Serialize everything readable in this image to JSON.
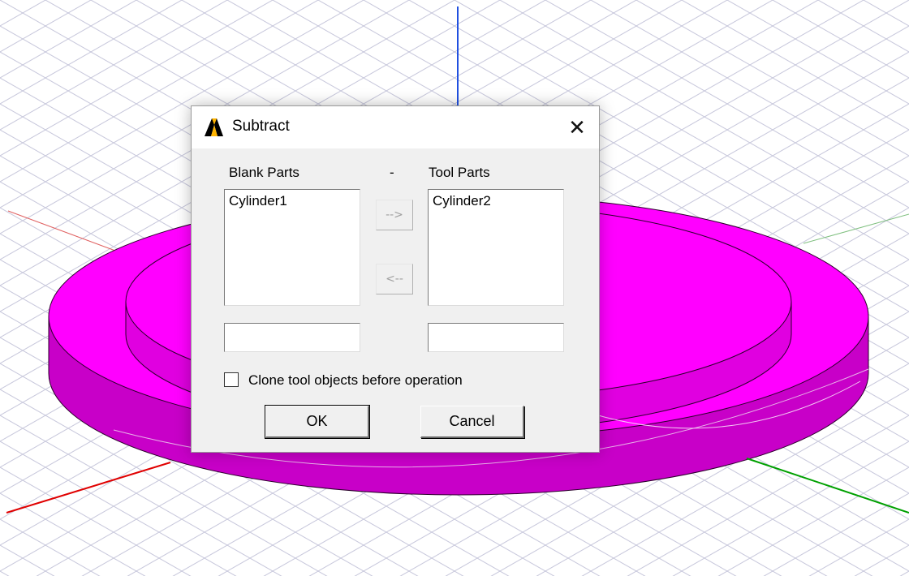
{
  "dialog": {
    "title": "Subtract",
    "close_glyph": "✕",
    "app_icon": "ansys-logo-icon",
    "blank_parts_label": "Blank Parts",
    "separator": "-",
    "tool_parts_label": "Tool Parts",
    "blank_parts": [
      "Cylinder1"
    ],
    "tool_parts": [
      "Cylinder2"
    ],
    "blank_input_value": "",
    "tool_input_value": "",
    "move_right_label": "-->",
    "move_left_label": "<--",
    "clone_label": "Clone tool objects before operation",
    "clone_checked": false,
    "ok_label": "OK",
    "cancel_label": "Cancel"
  },
  "viewport": {
    "model_color": "#ff00ff",
    "x_axis_color": "#e00000",
    "y_axis_color": "#00a000",
    "z_axis_color": "#2050e0",
    "grid_color": "#c8c8dc"
  }
}
